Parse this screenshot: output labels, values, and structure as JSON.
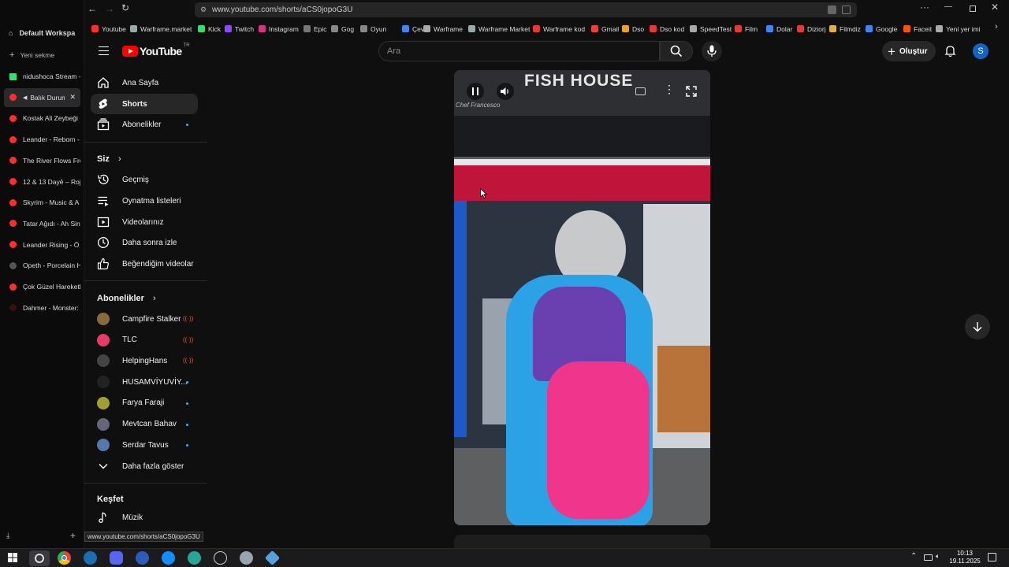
{
  "browser": {
    "url": "www.youtube.com/shorts/aCS0jopoG3U",
    "status_url": "www.youtube.com/shorts/aCS0jopoG3U",
    "workspace": "Default Workspa",
    "new_tab": "Yeni sekme",
    "tabs": [
      {
        "label": "nidushoca Stream -",
        "color": "#2ee36b"
      },
      {
        "label": "Balık Durumu",
        "color": "#ff2d2d"
      },
      {
        "label": "Kostak Ali Zeybeği",
        "color": "#ff2d2d"
      },
      {
        "label": "Leander - Reborn -",
        "color": "#ff2d2d"
      },
      {
        "label": "The River Flows Fro",
        "color": "#ff2d2d"
      },
      {
        "label": "12 & 13 Dayê – Roj",
        "color": "#ff2d2d"
      },
      {
        "label": "Skyrim - Music & A",
        "color": "#ff2d2d"
      },
      {
        "label": "Tatar Ağıdı - Ah Sin",
        "color": "#ff2d2d"
      },
      {
        "label": "Leander Rising - Ö",
        "color": "#ff2d2d"
      },
      {
        "label": "Opeth - Porcelain H",
        "color": "#555555"
      },
      {
        "label": "Çok Güzel Hareketl",
        "color": "#ff2d2d"
      },
      {
        "label": "Dahmer - Monster:",
        "color": "#3a1010"
      }
    ],
    "bookmarks": [
      {
        "label": "Youtube",
        "color": "#ff2d2d"
      },
      {
        "label": "Warframe.market",
        "color": "#9aa"
      },
      {
        "label": "Kick",
        "color": "#2ee36b"
      },
      {
        "label": "Twitch",
        "color": "#9146ff"
      },
      {
        "label": "Instagram",
        "color": "#d63384"
      },
      {
        "label": "Epic",
        "color": "#777"
      },
      {
        "label": "Gog",
        "color": "#888"
      },
      {
        "label": "Oyun",
        "color": "#888"
      },
      {
        "label": "Çeviri",
        "color": "#4285f4"
      },
      {
        "label": "Warframe",
        "color": "#aaa"
      },
      {
        "label": "Warframe Market",
        "color": "#9aa"
      },
      {
        "label": "Warframe kod",
        "color": "#e53935"
      },
      {
        "label": "Gmail",
        "color": "#ea4335"
      },
      {
        "label": "Dso",
        "color": "#f0a020"
      },
      {
        "label": "Dso kod",
        "color": "#e53935"
      },
      {
        "label": "SpeedTest",
        "color": "#aaa"
      },
      {
        "label": "Film",
        "color": "#e53935"
      },
      {
        "label": "Dolar",
        "color": "#4285f4"
      },
      {
        "label": "Diziorj",
        "color": "#e53935"
      },
      {
        "label": "Filmdiz",
        "color": "#e0b040"
      },
      {
        "label": "Google",
        "color": "#4285f4"
      },
      {
        "label": "Faceit",
        "color": "#ff5500"
      },
      {
        "label": "Yeni yer imi",
        "color": "#aaa"
      }
    ]
  },
  "youtube": {
    "logo": "YouTube",
    "region": "TR",
    "search_placeholder": "Ara",
    "create_label": "Oluştur",
    "avatar_letter": "S",
    "nav": [
      {
        "label": "Ana Sayfa"
      },
      {
        "label": "Shorts"
      },
      {
        "label": "Abonelikler"
      }
    ],
    "you_section": "Siz",
    "you_items": [
      {
        "label": "Geçmiş"
      },
      {
        "label": "Oynatma listeleri"
      },
      {
        "label": "Videolarınız"
      },
      {
        "label": "Daha sonra izle"
      },
      {
        "label": "Beğendiğim videolar"
      }
    ],
    "subs_section": "Abonelikler",
    "subscriptions": [
      {
        "label": "Campfire Stalker",
        "status": "live",
        "color": "#8a6a3a"
      },
      {
        "label": "TLC",
        "status": "live",
        "color": "#e43b6b"
      },
      {
        "label": "HelpingHans",
        "status": "live",
        "color": "#444"
      },
      {
        "label": "HUSAMVİYUVİY...",
        "status": "new",
        "color": "#222"
      },
      {
        "label": "Farya Faraji",
        "status": "new",
        "color": "#a0a030"
      },
      {
        "label": "Mevtcan Bahav",
        "status": "new",
        "color": "#667"
      },
      {
        "label": "Serdar Tavus",
        "status": "new",
        "color": "#5577aa"
      }
    ],
    "show_more": "Daha fazla göster",
    "explore_section": "Keşfet",
    "explore_items": [
      {
        "label": "Müzik"
      }
    ],
    "video": {
      "sign_text": "FISH HOUSE",
      "chef_text": "Chef Francesco"
    }
  },
  "taskbar": {
    "time": "10:13",
    "date": "19.11.2025"
  }
}
